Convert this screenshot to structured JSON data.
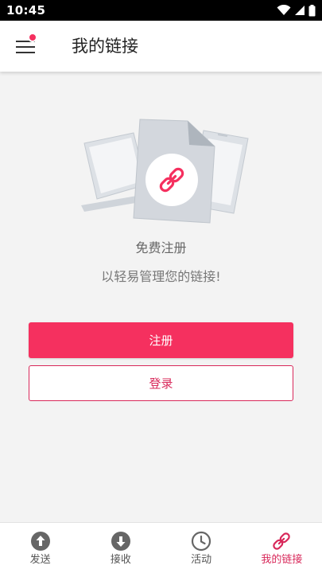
{
  "status_bar": {
    "time": "10:45"
  },
  "app_bar": {
    "title": "我的链接"
  },
  "empty_state": {
    "title": "免费注册",
    "subtitle": "以轻易管理您的链接!"
  },
  "actions": {
    "register_label": "注册",
    "login_label": "登录"
  },
  "bottom_nav": {
    "items": [
      {
        "label": "发送",
        "icon": "upload-circle-icon",
        "active": false
      },
      {
        "label": "接收",
        "icon": "download-circle-icon",
        "active": false
      },
      {
        "label": "活动",
        "icon": "clock-icon",
        "active": false
      },
      {
        "label": "我的链接",
        "icon": "link-icon",
        "active": true
      }
    ]
  },
  "colors": {
    "accent": "#f5305f",
    "accent_text": "#d8285a",
    "background": "#f3f3f3"
  }
}
